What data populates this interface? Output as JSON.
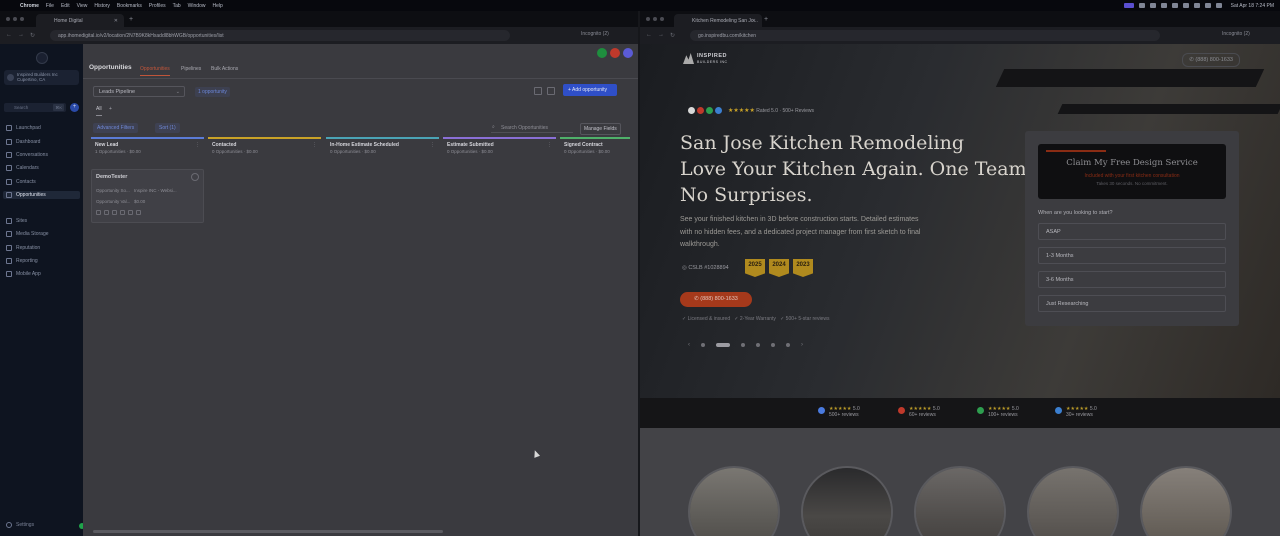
{
  "menubar": {
    "app": "Chrome",
    "items": [
      "File",
      "Edit",
      "View",
      "History",
      "Bookmarks",
      "Profiles",
      "Tab",
      "Window",
      "Help"
    ],
    "clock": "Sat Apr 18  7:24 PM"
  },
  "left": {
    "tab_title": "Home Digital",
    "url": "app.ihomedigital.io/v2/location/2N7B9K8kHxaddl8bhWGB/opportunities/list",
    "incognito": "Incognito (2)",
    "sidebar": {
      "account_name": "Inspired Builders Inc",
      "account_sub": "Cupertino, CA",
      "search_placeholder": "Search",
      "search_key": "⌘K",
      "items": [
        "Launchpad",
        "Dashboard",
        "Conversations",
        "Calendars",
        "Contacts",
        "Opportunities",
        "Sites",
        "Media Storage",
        "Reputation",
        "Reporting",
        "Mobile App"
      ],
      "settings": "Settings"
    },
    "page_title": "Opportunities",
    "tabs": [
      "Opportunities",
      "Pipelines",
      "Bulk Actions"
    ],
    "pipeline_select": "Leads Pipeline",
    "opp_count": "1 opportunity",
    "add_button": "+ Add opportunity",
    "view_all": "All",
    "advanced_filters": "Advanced Filters",
    "sort": "Sort (1)",
    "search_placeholder": "Search Opportunities",
    "manage_fields": "Manage Fields",
    "columns": [
      {
        "name": "New Lead",
        "count": "1 Opportunities",
        "amount": "$0.00",
        "color": "#5b7bd6"
      },
      {
        "name": "Contacted",
        "count": "0 Opportunities",
        "amount": "$0.00",
        "color": "#c9a227"
      },
      {
        "name": "In-Home Estimate Scheduled",
        "count": "0 Opportunities",
        "amount": "$0.00",
        "color": "#4aa3b5"
      },
      {
        "name": "Estimate Submitted",
        "count": "0 Opportunities",
        "amount": "$0.00",
        "color": "#8a6fd6"
      },
      {
        "name": "Signed Contract",
        "count": "0 Opportunities",
        "amount": "$0.00",
        "color": "#4fb06a"
      }
    ],
    "card": {
      "title": "DemoTester",
      "row1_label": "Opportunity So...",
      "row1_value": "Inspire INC - Websi...",
      "row2_label": "Opportunity Val...",
      "row2_value": "$0.00"
    }
  },
  "right": {
    "tab_title": "Kitchen Remodeling San Jo...",
    "url": "go.inspiredbu.com/kitchen",
    "incognito": "Incognito (2)",
    "logo_line1": "INSPIRED",
    "logo_line2": "BUILDERS INC",
    "call_top": "(888) 800-1633",
    "rating_text": "Rated 5.0",
    "review_count": "500+ Reviews",
    "headline_lines": [
      "San Jose Kitchen Remodeling",
      "Love Your Kitchen Again. One Team,",
      "No Surprises."
    ],
    "subtext": "See your finished kitchen in 3D before construction starts. Detailed estimates with no hidden fees, and a dedicated project manager from first sketch to final walkthrough.",
    "csl": "CSLB #1028894",
    "badges": [
      "2025",
      "2024",
      "2023"
    ],
    "call_button": "(888) 800-1633",
    "trust": [
      "Licensed & insured",
      "2-Year Warranty",
      "500+ 5-star reviews"
    ],
    "form": {
      "title": "Claim My Free Design Service",
      "subtitle": "Included with your first kitchen consultation",
      "note": "Takes 30 seconds. No commitment.",
      "question": "When are you looking to start?",
      "options": [
        "ASAP",
        "1-3 Months",
        "3-6 Months",
        "Just Researching"
      ]
    },
    "reviews": [
      {
        "score": "5.0",
        "label": "500+ reviews",
        "color": "#4a7be0"
      },
      {
        "score": "5.0",
        "label": "60+ reviews",
        "color": "#c0392b"
      },
      {
        "score": "5.0",
        "label": "100+ reviews",
        "color": "#2e9e4f"
      },
      {
        "score": "5.0",
        "label": "30+ reviews",
        "color": "#3b7fd0"
      }
    ]
  }
}
